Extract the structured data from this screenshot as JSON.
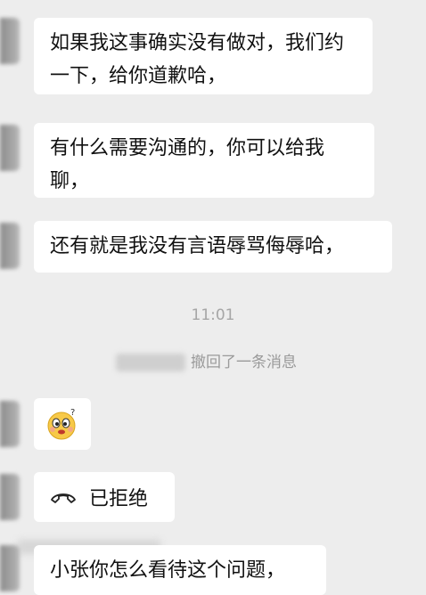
{
  "messages": [
    {
      "text": "如果我这事确实没有做对，我们约\n一下，给你道歉哈，"
    },
    {
      "text": "有什么需要沟通的，你可以给我\n聊，"
    },
    {
      "text": "还有就是我没有言语辱骂侮辱哈，"
    }
  ],
  "timestamp": "11:01",
  "recall_notice": "撤回了一条消息",
  "emoji_name": "thinking-face-emoji",
  "call": {
    "icon": "hangup-phone-icon",
    "label": "已拒绝"
  },
  "last_message": {
    "text": "小张你怎么看待这个问题，"
  }
}
